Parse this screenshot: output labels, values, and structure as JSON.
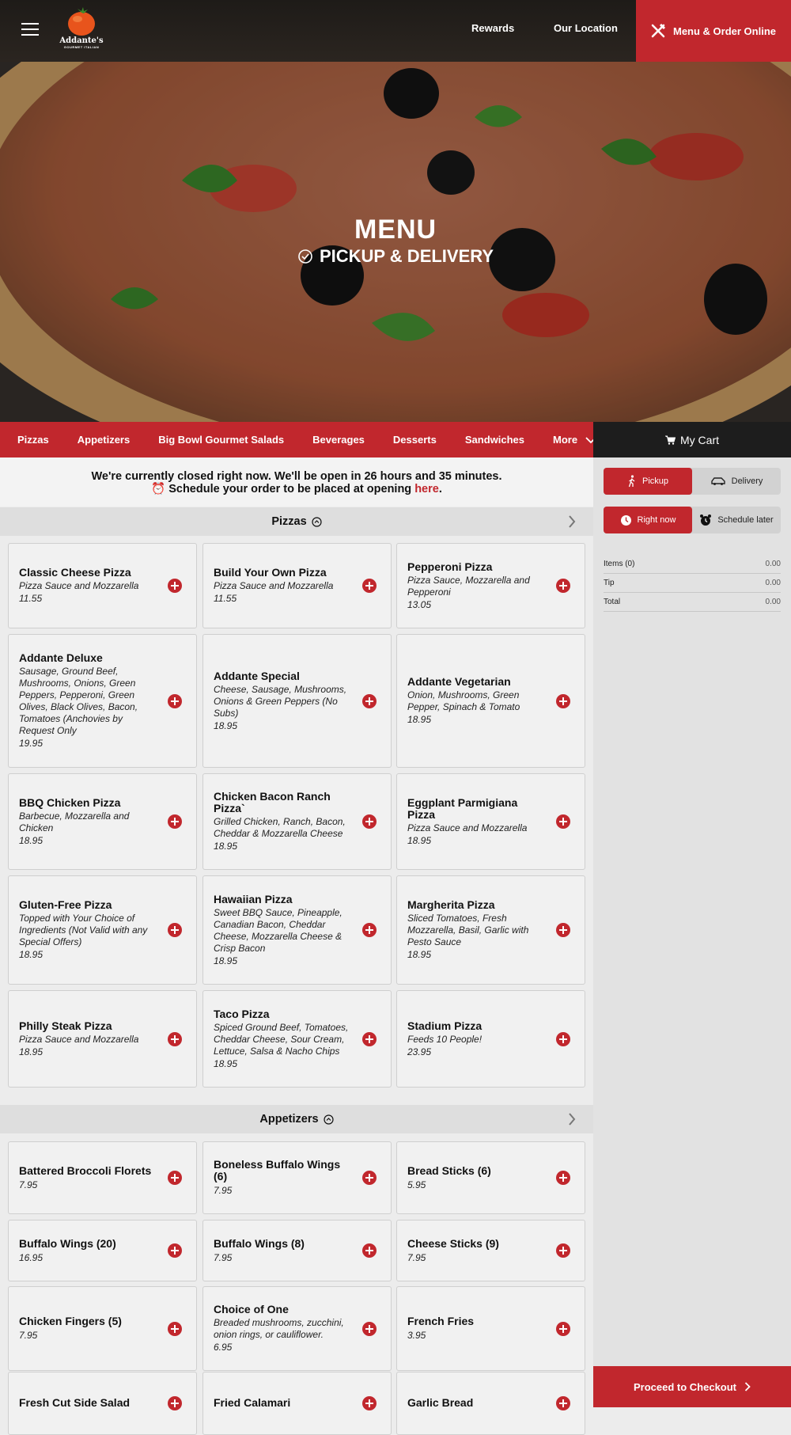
{
  "header": {
    "logo_name": "Addante's",
    "logo_tagline": "GOURMET ITALIAN",
    "nav": [
      "Rewards",
      "Our Location"
    ],
    "order_button": "Menu & Order Online"
  },
  "hero": {
    "title": "MENU",
    "subtitle": "PICKUP & DELIVERY"
  },
  "categories": [
    "Pizzas",
    "Appetizers",
    "Big Bowl Gourmet Salads",
    "Beverages",
    "Desserts",
    "Sandwiches",
    "More"
  ],
  "cart": {
    "label": "My Cart"
  },
  "notice": {
    "line1": "We're currently closed right now. We'll be open in 26 hours and 35 minutes.",
    "line2": "Schedule your order to be placed at opening",
    "link": "here",
    "end": "."
  },
  "sections": {
    "pizzas": {
      "title": "Pizzas",
      "items": [
        {
          "name": "Classic Cheese Pizza",
          "desc": "Pizza Sauce and Mozzarella",
          "price": "11.55"
        },
        {
          "name": "Build Your Own Pizza",
          "desc": "Pizza Sauce and Mozzarella",
          "price": "11.55"
        },
        {
          "name": "Pepperoni Pizza",
          "desc": "Pizza Sauce, Mozzarella and Pepperoni",
          "price": "13.05"
        },
        {
          "name": "Addante Deluxe",
          "desc": "Sausage, Ground Beef, Mushrooms, Onions, Green Peppers, Pepperoni, Green Olives, Black Olives, Bacon, Tomatoes (Anchovies by Request Only",
          "price": "19.95"
        },
        {
          "name": "Addante Special",
          "desc": "Cheese, Sausage, Mushrooms, Onions & Green Peppers (No Subs)",
          "price": "18.95"
        },
        {
          "name": "Addante Vegetarian",
          "desc": "Onion, Mushrooms, Green Pepper, Spinach & Tomato",
          "price": "18.95"
        },
        {
          "name": "BBQ Chicken Pizza",
          "desc": "Barbecue, Mozzarella and Chicken",
          "price": "18.95"
        },
        {
          "name": "Chicken Bacon Ranch Pizza`",
          "desc": "Grilled Chicken, Ranch, Bacon, Cheddar & Mozzarella Cheese",
          "price": "18.95"
        },
        {
          "name": "Eggplant Parmigiana Pizza",
          "desc": "Pizza Sauce and Mozzarella",
          "price": "18.95"
        },
        {
          "name": "Gluten-Free Pizza",
          "desc": "Topped with Your Choice of Ingredients (Not Valid with any Special Offers)",
          "price": "18.95"
        },
        {
          "name": "Hawaiian Pizza",
          "desc": "Sweet BBQ Sauce, Pineapple, Canadian Bacon, Cheddar Cheese, Mozzarella Cheese & Crisp Bacon",
          "price": "18.95"
        },
        {
          "name": "Margherita Pizza",
          "desc": "Sliced Tomatoes, Fresh Mozzarella, Basil, Garlic with Pesto Sauce",
          "price": "18.95"
        },
        {
          "name": "Philly Steak Pizza",
          "desc": "Pizza Sauce and Mozzarella",
          "price": "18.95"
        },
        {
          "name": "Taco Pizza",
          "desc": "Spiced Ground Beef, Tomatoes, Cheddar Cheese, Sour Cream, Lettuce, Salsa & Nacho Chips",
          "price": "18.95"
        },
        {
          "name": "Stadium Pizza",
          "desc": "Feeds 10 People!",
          "price": "23.95"
        }
      ]
    },
    "appetizers": {
      "title": "Appetizers",
      "items": [
        {
          "name": "Battered Broccoli Florets",
          "desc": "",
          "price": "7.95"
        },
        {
          "name": "Boneless Buffalo Wings (6)",
          "desc": "",
          "price": "7.95"
        },
        {
          "name": "Bread Sticks (6)",
          "desc": "",
          "price": "5.95"
        },
        {
          "name": "Buffalo Wings (20)",
          "desc": "",
          "price": "16.95"
        },
        {
          "name": "Buffalo Wings (8)",
          "desc": "",
          "price": "7.95"
        },
        {
          "name": "Cheese Sticks (9)",
          "desc": "",
          "price": "7.95"
        },
        {
          "name": "Chicken Fingers (5)",
          "desc": "",
          "price": "7.95"
        },
        {
          "name": "Choice of One",
          "desc": "Breaded mushrooms, zucchini, onion rings, or cauliflower.",
          "price": "6.95"
        },
        {
          "name": "French Fries",
          "desc": "",
          "price": "3.95"
        },
        {
          "name": "Fresh Cut Side Salad",
          "desc": "",
          "price": ""
        },
        {
          "name": "Fried Calamari",
          "desc": "",
          "price": ""
        },
        {
          "name": "Garlic Bread",
          "desc": "",
          "price": ""
        }
      ]
    }
  },
  "sidebar": {
    "mode": {
      "pickup": "Pickup",
      "delivery": "Delivery",
      "selected": "pickup"
    },
    "timing": {
      "now": "Right now",
      "later": "Schedule later",
      "selected": "now"
    },
    "summary": [
      {
        "label": "Items (0)",
        "value": "0.00"
      },
      {
        "label": "Tip",
        "value": "0.00"
      },
      {
        "label": "Total",
        "value": "0.00"
      }
    ],
    "checkout": "Proceed to Checkout"
  },
  "colors": {
    "accent": "#c1272d",
    "dark": "#1d1d1d"
  }
}
